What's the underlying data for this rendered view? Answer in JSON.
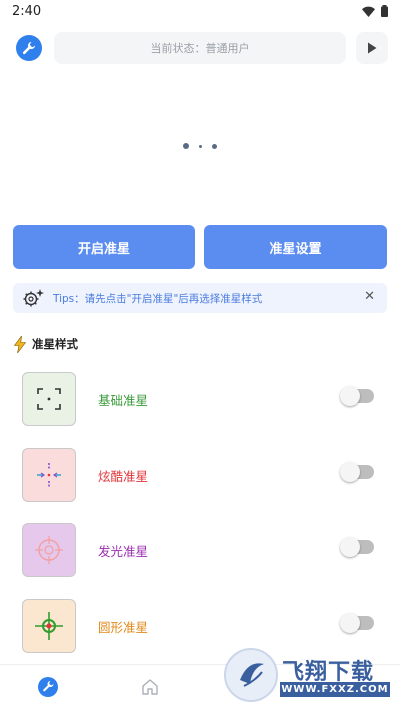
{
  "status_bar": {
    "time": "2:40"
  },
  "header": {
    "status_text": "当前状态：普通用户"
  },
  "actions": {
    "primary_label": "开启准星",
    "secondary_label": "准星设置"
  },
  "tips": {
    "text": "Tips：请先点击\"开启准星\"后再选择准星样式",
    "close_label": "✕"
  },
  "section": {
    "title": "准星样式"
  },
  "styles": [
    {
      "name": "基础准星",
      "color": "#3a9a3a",
      "thumb_bg": "#eaf2e6",
      "enabled": false
    },
    {
      "name": "炫酷准星",
      "color": "#e0353b",
      "thumb_bg": "#fbdcdc",
      "enabled": false
    },
    {
      "name": "发光准星",
      "color": "#9b2fb0",
      "thumb_bg": "#e6c8ec",
      "enabled": false
    },
    {
      "name": "圆形准星",
      "color": "#e08a18",
      "thumb_bg": "#fbe7cf",
      "enabled": false
    }
  ],
  "watermark": {
    "title": "飞翔下载",
    "url": "WWW.FXXZ.COM"
  },
  "colors": {
    "accent": "#5b8cf0",
    "brand_blue": "#2f80ed",
    "tips_text": "#4a7be0"
  },
  "icons": {
    "header_left": "wrench-icon",
    "header_right": "play-icon",
    "tips": "gear-sparkle-icon",
    "section": "lightning-icon",
    "nav": [
      "wrench-icon",
      "home-icon"
    ]
  }
}
